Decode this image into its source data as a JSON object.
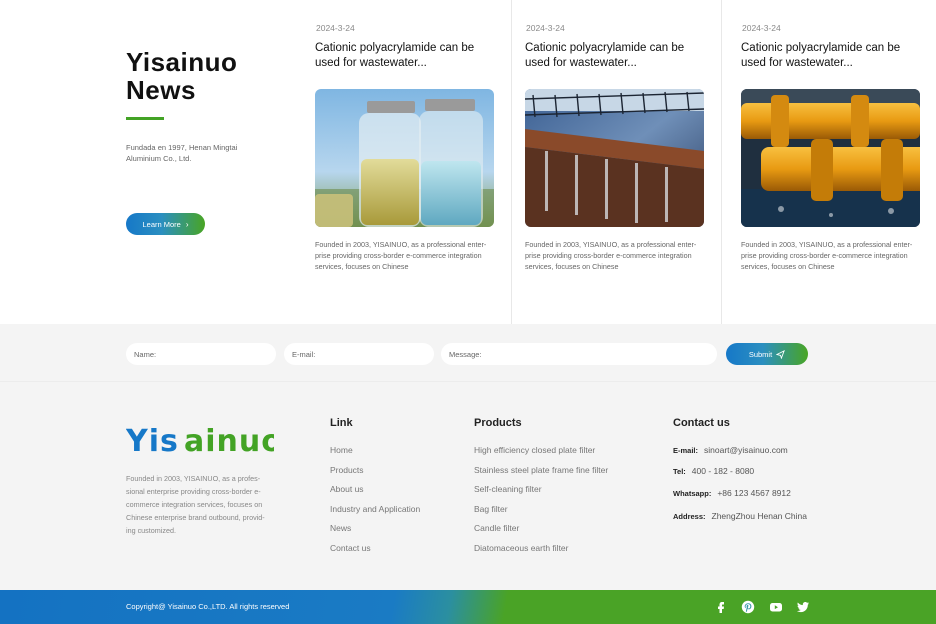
{
  "news": {
    "title_line1": "Yisainuo",
    "title_line2": "News",
    "description": "Fundada en 1997, Henan Mingtai Aluminium Co., Ltd.",
    "learn_more_label": "Learn More",
    "cards": [
      {
        "date": "2024-3-24",
        "title": "Cationic polyacrylamide can be used for wastewater...",
        "image_icon": "glass-jars-photo",
        "text": "Founded in 2003, YISAINUO, as a professional enter-prise providing cross-border e-commerce integration services, focuses on Chinese"
      },
      {
        "date": "2024-3-24",
        "title": "Cationic polyacrylamide can be used for wastewater...",
        "image_icon": "water-treatment-photo",
        "text": "Founded in 2003, YISAINUO, as a professional enter-prise providing cross-border e-commerce integration services, focuses on Chinese"
      },
      {
        "date": "2024-3-24",
        "title": "Cationic polyacrylamide can be used for wastewater...",
        "image_icon": "pipeline-photo",
        "text": "Founded in 2003, YISAINUO, as a professional enter-prise providing cross-border e-commerce integration services, focuses on Chinese"
      }
    ]
  },
  "form": {
    "name_placeholder": "Name:",
    "email_placeholder": "E-mail:",
    "message_placeholder": "Message:",
    "submit_label": "Submit"
  },
  "footer": {
    "logo_text": "YISAINUO",
    "description": "Founded in 2003, YISAINUO, as a profes-sional enterprise providing cross-border e-commerce integration services, focuses on Chinese enterprise brand outbound, provid-ing customized.",
    "link_title": "Link",
    "links": [
      "Home",
      "Products",
      "About us",
      "Industry and Application",
      "News",
      "Contact us"
    ],
    "products_title": "Products",
    "products": [
      "High efficiency closed plate filter",
      "Stainless steel plate frame fine filter",
      "Self-cleaning filter",
      "Bag filter",
      "Candle filter",
      "Diatomaceous earth filter"
    ],
    "contact_title": "Contact us",
    "email_label": "E-mail:",
    "email_value": "sinoart@yisainuo.com",
    "tel_label": "Tel:",
    "tel_value": "400 - 182 - 8080",
    "whatsapp_label": "Whatsapp:",
    "whatsapp_value": "+86 123 4567 8912",
    "address_label": "Address:",
    "address_value": "ZhengZhou  Henan China"
  },
  "bottom": {
    "copyright": "Copyright@ Yisainuo Co.,LTD. All rights reserved",
    "social_icons": [
      "facebook-icon",
      "pinterest-icon",
      "youtube-icon",
      "twitter-icon"
    ]
  },
  "colors": {
    "brand_blue": "#1678c8",
    "brand_green": "#43a325"
  }
}
